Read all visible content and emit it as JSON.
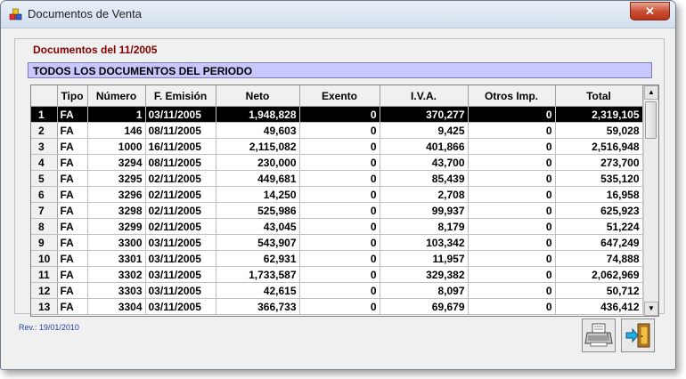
{
  "window": {
    "title": "Documentos de Venta",
    "close_label": "✕"
  },
  "group": {
    "label": "Documentos del 11/2005",
    "period_label": "TODOS LOS DOCUMENTOS DEL PERIODO"
  },
  "table": {
    "columns": [
      "Tipo",
      "Número",
      "F. Emisión",
      "Neto",
      "Exento",
      "I.V.A.",
      "Otros Imp.",
      "Total"
    ],
    "rows": [
      {
        "n": "1",
        "tipo": "FA",
        "numero": "1",
        "fecha": "03/11/2005",
        "neto": "1,948,828",
        "exento": "0",
        "iva": "370,277",
        "otros": "0",
        "total": "2,319,105"
      },
      {
        "n": "2",
        "tipo": "FA",
        "numero": "146",
        "fecha": "08/11/2005",
        "neto": "49,603",
        "exento": "0",
        "iva": "9,425",
        "otros": "0",
        "total": "59,028"
      },
      {
        "n": "3",
        "tipo": "FA",
        "numero": "1000",
        "fecha": "16/11/2005",
        "neto": "2,115,082",
        "exento": "0",
        "iva": "401,866",
        "otros": "0",
        "total": "2,516,948"
      },
      {
        "n": "4",
        "tipo": "FA",
        "numero": "3294",
        "fecha": "08/11/2005",
        "neto": "230,000",
        "exento": "0",
        "iva": "43,700",
        "otros": "0",
        "total": "273,700"
      },
      {
        "n": "5",
        "tipo": "FA",
        "numero": "3295",
        "fecha": "02/11/2005",
        "neto": "449,681",
        "exento": "0",
        "iva": "85,439",
        "otros": "0",
        "total": "535,120"
      },
      {
        "n": "6",
        "tipo": "FA",
        "numero": "3296",
        "fecha": "02/11/2005",
        "neto": "14,250",
        "exento": "0",
        "iva": "2,708",
        "otros": "0",
        "total": "16,958"
      },
      {
        "n": "7",
        "tipo": "FA",
        "numero": "3298",
        "fecha": "02/11/2005",
        "neto": "525,986",
        "exento": "0",
        "iva": "99,937",
        "otros": "0",
        "total": "625,923"
      },
      {
        "n": "8",
        "tipo": "FA",
        "numero": "3299",
        "fecha": "02/11/2005",
        "neto": "43,045",
        "exento": "0",
        "iva": "8,179",
        "otros": "0",
        "total": "51,224"
      },
      {
        "n": "9",
        "tipo": "FA",
        "numero": "3300",
        "fecha": "03/11/2005",
        "neto": "543,907",
        "exento": "0",
        "iva": "103,342",
        "otros": "0",
        "total": "647,249"
      },
      {
        "n": "10",
        "tipo": "FA",
        "numero": "3301",
        "fecha": "03/11/2005",
        "neto": "62,931",
        "exento": "0",
        "iva": "11,957",
        "otros": "0",
        "total": "74,888"
      },
      {
        "n": "11",
        "tipo": "FA",
        "numero": "3302",
        "fecha": "03/11/2005",
        "neto": "1,733,587",
        "exento": "0",
        "iva": "329,382",
        "otros": "0",
        "total": "2,062,969"
      },
      {
        "n": "12",
        "tipo": "FA",
        "numero": "3303",
        "fecha": "03/11/2005",
        "neto": "42,615",
        "exento": "0",
        "iva": "8,097",
        "otros": "0",
        "total": "50,712"
      },
      {
        "n": "13",
        "tipo": "FA",
        "numero": "3304",
        "fecha": "03/11/2005",
        "neto": "366,733",
        "exento": "0",
        "iva": "69,679",
        "otros": "0",
        "total": "436,412"
      }
    ],
    "selected_row": 0
  },
  "footer": {
    "revision": "Rev.: 19/01/2010"
  },
  "icons": {
    "app": "app-cubes-icon",
    "print": "printer-icon",
    "exit": "exit-door-icon",
    "scroll_up": "scroll-up-arrow-icon",
    "scroll_down": "scroll-down-arrow-icon"
  },
  "colors": {
    "group_label": "#800000",
    "period_bar": "#c8c8ff",
    "revision_text": "#1f3fa0",
    "selected_row": "#000000"
  }
}
